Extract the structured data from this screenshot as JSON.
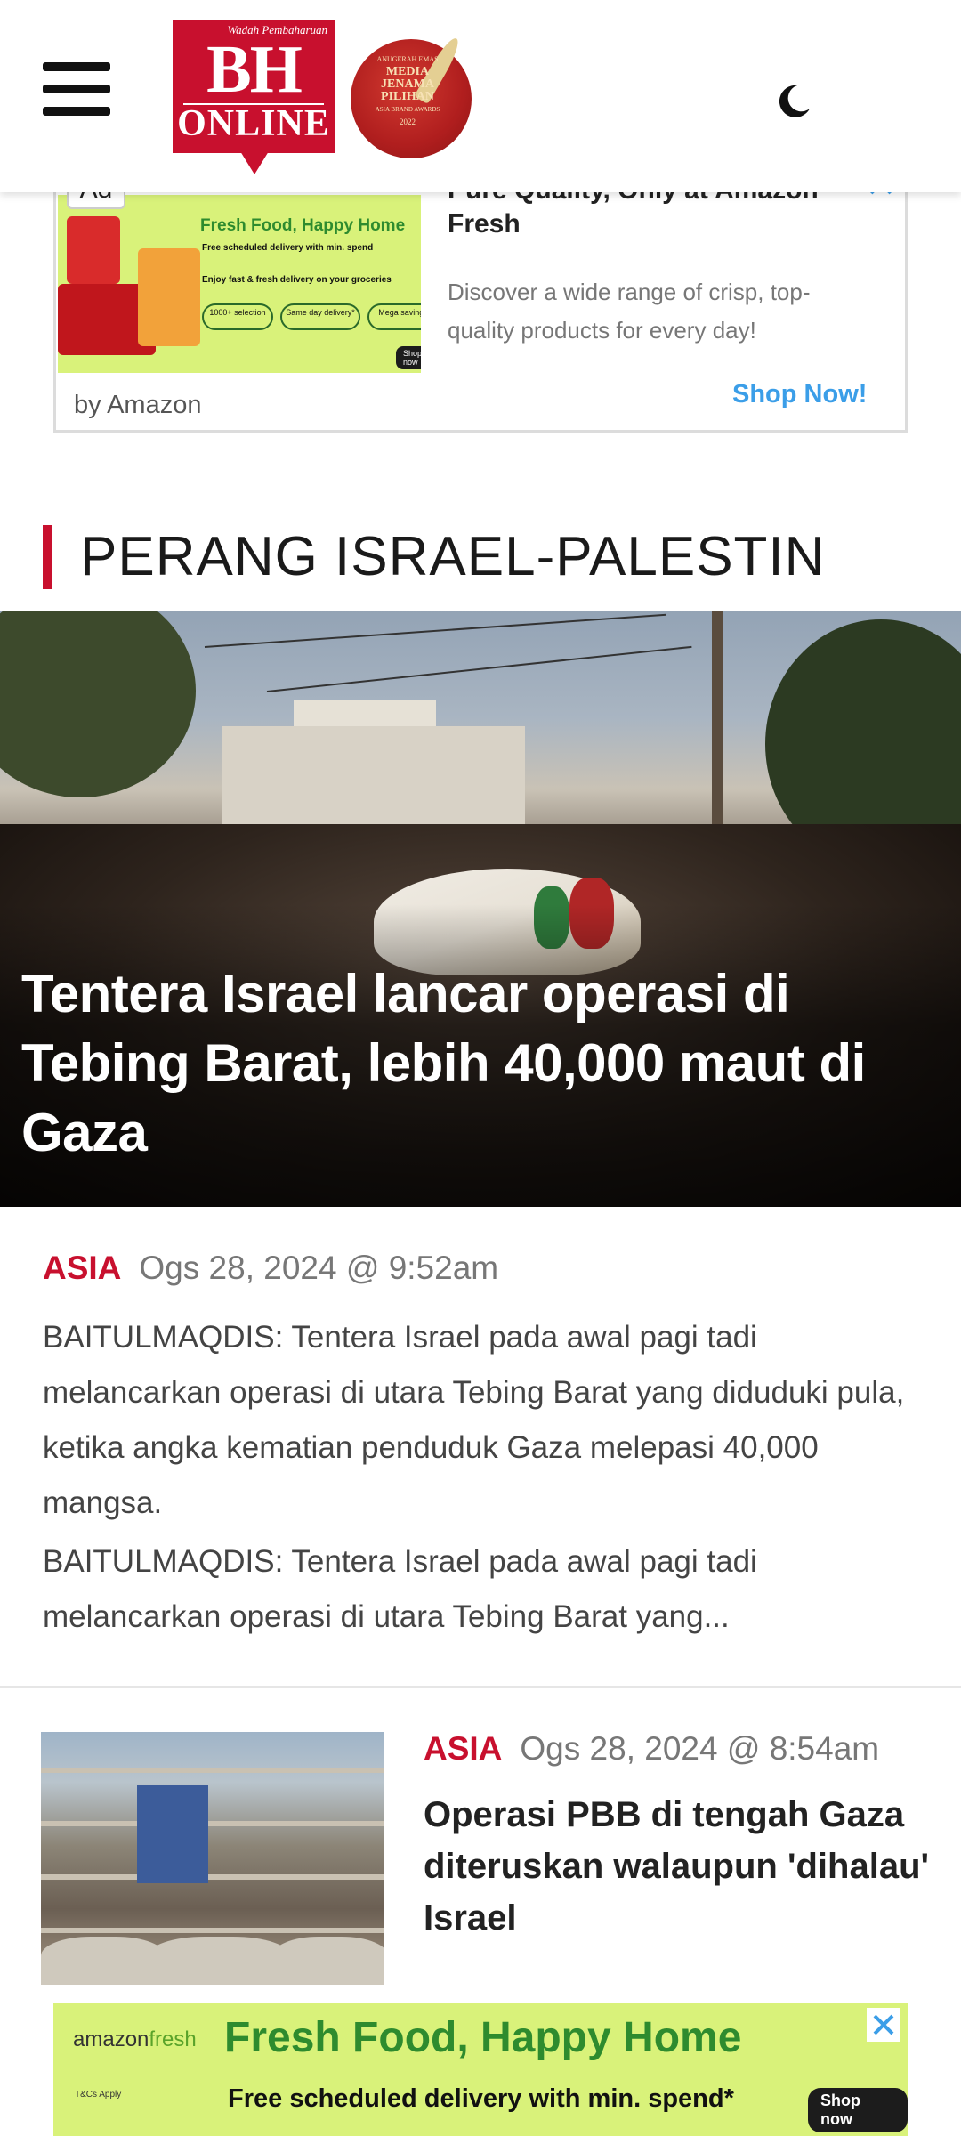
{
  "header": {
    "logo": {
      "tagline": "Wadah Pembaharuan",
      "name_top": "BH",
      "name_bottom": "ONLINE"
    },
    "award": {
      "line1": "ANUGERAH EMAS",
      "line2": "MEDIA",
      "line3": "JENAMA",
      "line4": "PILIHAN",
      "line5": "ASIA BRAND AWARDS",
      "line6": "2022"
    },
    "menu_icon": "hamburger-icon",
    "theme_icon": "moon-icon"
  },
  "ad_top": {
    "label": "Ad",
    "image": {
      "title": "Fresh Food, Happy Home",
      "subtitle": "Free scheduled delivery with min. spend",
      "subtitle2": "Enjoy fast & fresh delivery on your groceries",
      "pills": [
        "1000+ selection",
        "Same day delivery*",
        "Mega savings"
      ],
      "button": "Shop now"
    },
    "headline": "Pure Quality, Only at Amazon Fresh",
    "description": "Discover a wide range of crisp, top-quality products for every day!",
    "cta": "Shop Now!",
    "advertiser": "by Amazon"
  },
  "section": {
    "title": "PERANG ISRAEL-PALESTIN"
  },
  "featured": {
    "title": "Tentera Israel lancar operasi di Tebing Barat, lebih 40,000 maut di Gaza",
    "category": "ASIA",
    "date": "Ogs 28, 2024 @ 9:52am",
    "summary": "BAITULMAQDIS: Tentera Israel pada awal pagi tadi melancarkan operasi di utara Tebing Barat yang diduduki pula, ketika angka kematian penduduk Gaza melepasi 40,000 mangsa.",
    "excerpt": "BAITULMAQDIS: Tentera Israel pada awal pagi tadi melancarkan operasi di utara Tebing Barat yang..."
  },
  "article2": {
    "category": "ASIA",
    "date": "Ogs 28, 2024 @ 8:54am",
    "title": "Operasi PBB di tengah Gaza diteruskan walaupun 'dihalau' Israel"
  },
  "ad_bottom": {
    "brand_a": "amazon",
    "brand_b": "fresh",
    "title": "Fresh Food, Happy Home",
    "subtitle": "Free scheduled delivery with min. spend*",
    "small": "T&Cs Apply",
    "button": "Shop now"
  },
  "colors": {
    "accent": "#c8102e",
    "link": "#3b9ee8",
    "ad_green": "#d9f27a"
  }
}
